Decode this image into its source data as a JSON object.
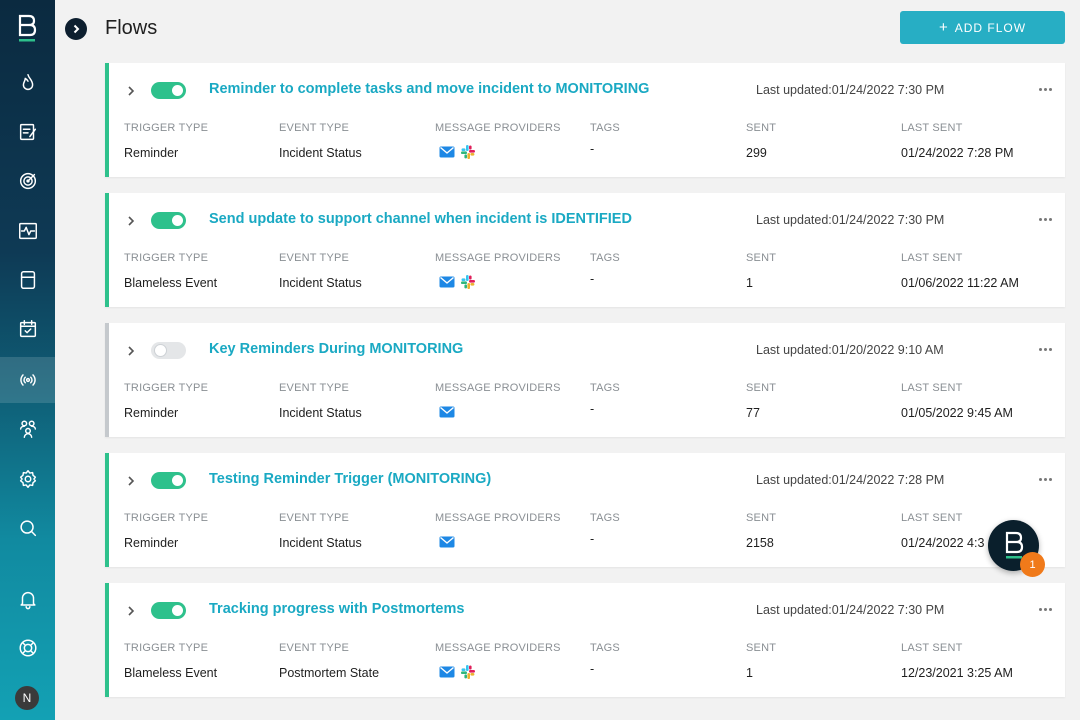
{
  "header": {
    "title": "Flows",
    "add_flow_label": "ADD FLOW"
  },
  "sidebar": {
    "items": [
      {
        "icon": "flame-icon"
      },
      {
        "icon": "notepad-icon"
      },
      {
        "icon": "target-icon"
      },
      {
        "icon": "pulse-monitor-icon"
      },
      {
        "icon": "archive-icon"
      },
      {
        "icon": "calendar-check-icon"
      },
      {
        "icon": "broadcast-icon",
        "active": true
      },
      {
        "icon": "team-icon"
      },
      {
        "icon": "gear-icon"
      },
      {
        "icon": "search-icon"
      },
      {
        "icon": "bell-icon"
      },
      {
        "icon": "lifebuoy-icon"
      }
    ],
    "avatar_initial": "N"
  },
  "column_labels": {
    "trigger_type": "TRIGGER TYPE",
    "event_type": "EVENT TYPE",
    "message_providers": "MESSAGE PROVIDERS",
    "tags": "TAGS",
    "sent": "SENT",
    "last_sent": "LAST SENT"
  },
  "flows": [
    {
      "title": "Reminder to complete tasks and move incident to MONITORING",
      "enabled": true,
      "last_updated": "Last updated:01/24/2022 7:30 PM",
      "trigger_type": "Reminder",
      "event_type": "Incident Status",
      "providers": [
        "email",
        "slack"
      ],
      "tags": "-",
      "sent": "299",
      "last_sent": "01/24/2022 7:28 PM"
    },
    {
      "title": "Send update to support channel when incident is IDENTIFIED",
      "enabled": true,
      "last_updated": "Last updated:01/24/2022 7:30 PM",
      "trigger_type": "Blameless Event",
      "event_type": "Incident Status",
      "providers": [
        "email",
        "slack"
      ],
      "tags": "-",
      "sent": "1",
      "last_sent": "01/06/2022 11:22 AM"
    },
    {
      "title": "Key Reminders During MONITORING",
      "enabled": false,
      "last_updated": "Last updated:01/20/2022 9:10 AM",
      "trigger_type": "Reminder",
      "event_type": "Incident Status",
      "providers": [
        "email"
      ],
      "tags": "-",
      "sent": "77",
      "last_sent": "01/05/2022 9:45 AM"
    },
    {
      "title": "Testing Reminder Trigger (MONITORING)",
      "enabled": true,
      "last_updated": "Last updated:01/24/2022 7:28 PM",
      "trigger_type": "Reminder",
      "event_type": "Incident Status",
      "providers": [
        "email"
      ],
      "tags": "-",
      "sent": "2158",
      "last_sent": "01/24/2022 4:3"
    },
    {
      "title": "Tracking progress with Postmortems",
      "enabled": true,
      "last_updated": "Last updated:01/24/2022 7:30 PM",
      "trigger_type": "Blameless Event",
      "event_type": "Postmortem State",
      "providers": [
        "email",
        "slack"
      ],
      "tags": "-",
      "sent": "1",
      "last_sent": "12/23/2021 3:25 AM"
    }
  ],
  "chat_widget": {
    "badge_count": "1"
  },
  "colors": {
    "accent": "#1aa9c3",
    "button": "#27aec4",
    "enabled": "#2ec18c",
    "badge": "#f07a1a"
  }
}
